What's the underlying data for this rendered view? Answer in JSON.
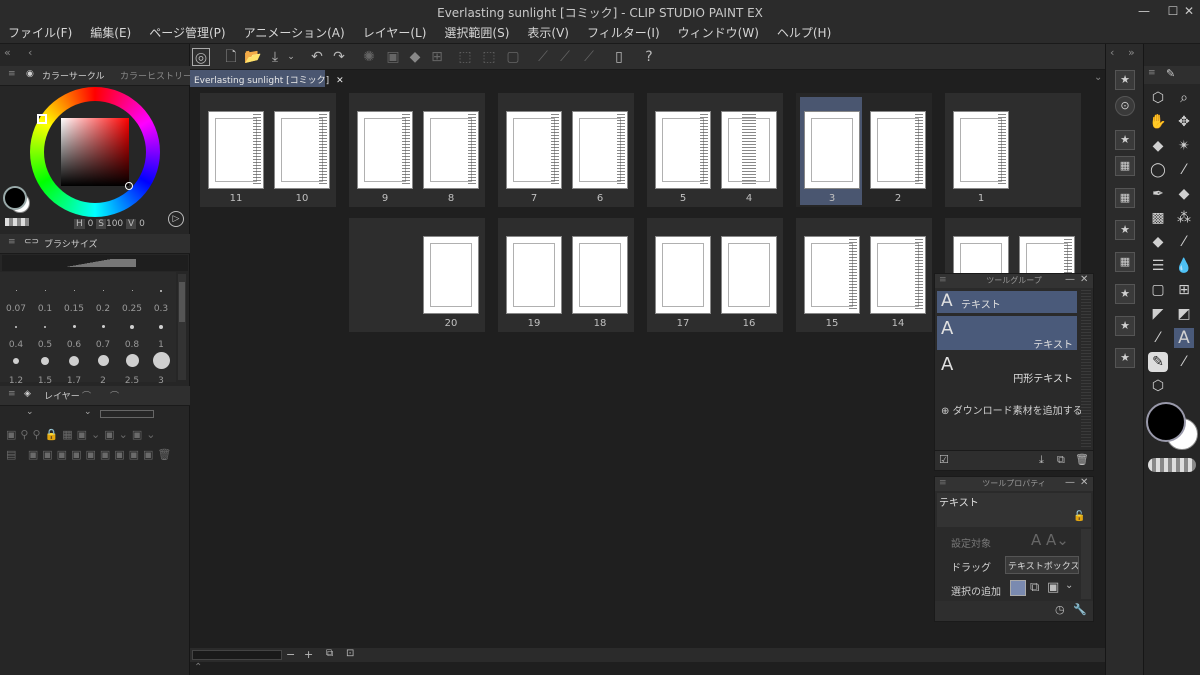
{
  "window": {
    "title": "Everlasting sunlight [コミック] - CLIP STUDIO PAINT EX"
  },
  "menu": [
    "ファイル(F)",
    "編集(E)",
    "ページ管理(P)",
    "アニメーション(A)",
    "レイヤー(L)",
    "選択範囲(S)",
    "表示(V)",
    "フィルター(I)",
    "ウィンドウ(W)",
    "ヘルプ(H)"
  ],
  "left": {
    "color_tab": "カラーサークル",
    "color_history_tab": "カラーヒストリー",
    "hsv": {
      "h": "0",
      "s": "100",
      "v": "0"
    },
    "brush_tab": "ブラシサイズ",
    "brush_sizes": [
      "0.07",
      "0.1",
      "0.15",
      "0.2",
      "0.25",
      "0.3",
      "0.4",
      "0.5",
      "0.6",
      "0.7",
      "0.8",
      "1",
      "1.2",
      "1.5",
      "1.7",
      "2",
      "2.5",
      "3"
    ],
    "layer_tab": "レイヤー"
  },
  "document": {
    "tab_label": "Everlasting sunlight [コミック]"
  },
  "pages": {
    "row1": [
      "11",
      "10",
      "9",
      "8",
      "7",
      "6",
      "5",
      "4",
      "3",
      "2",
      "1"
    ],
    "row2": [
      "20",
      "19",
      "18",
      "17",
      "16",
      "15",
      "14"
    ]
  },
  "tool_group": {
    "title": "ツールグループ",
    "items": [
      "テキスト",
      "テキスト",
      "円形テキスト"
    ],
    "add_material": "ダウンロード素材を追加する"
  },
  "tool_property": {
    "title": "ツールプロパティ",
    "name": "テキスト",
    "rows": [
      "設定対象",
      "ドラッグ",
      "選択の追加"
    ],
    "drag_value": "テキストボックス/ "
  }
}
